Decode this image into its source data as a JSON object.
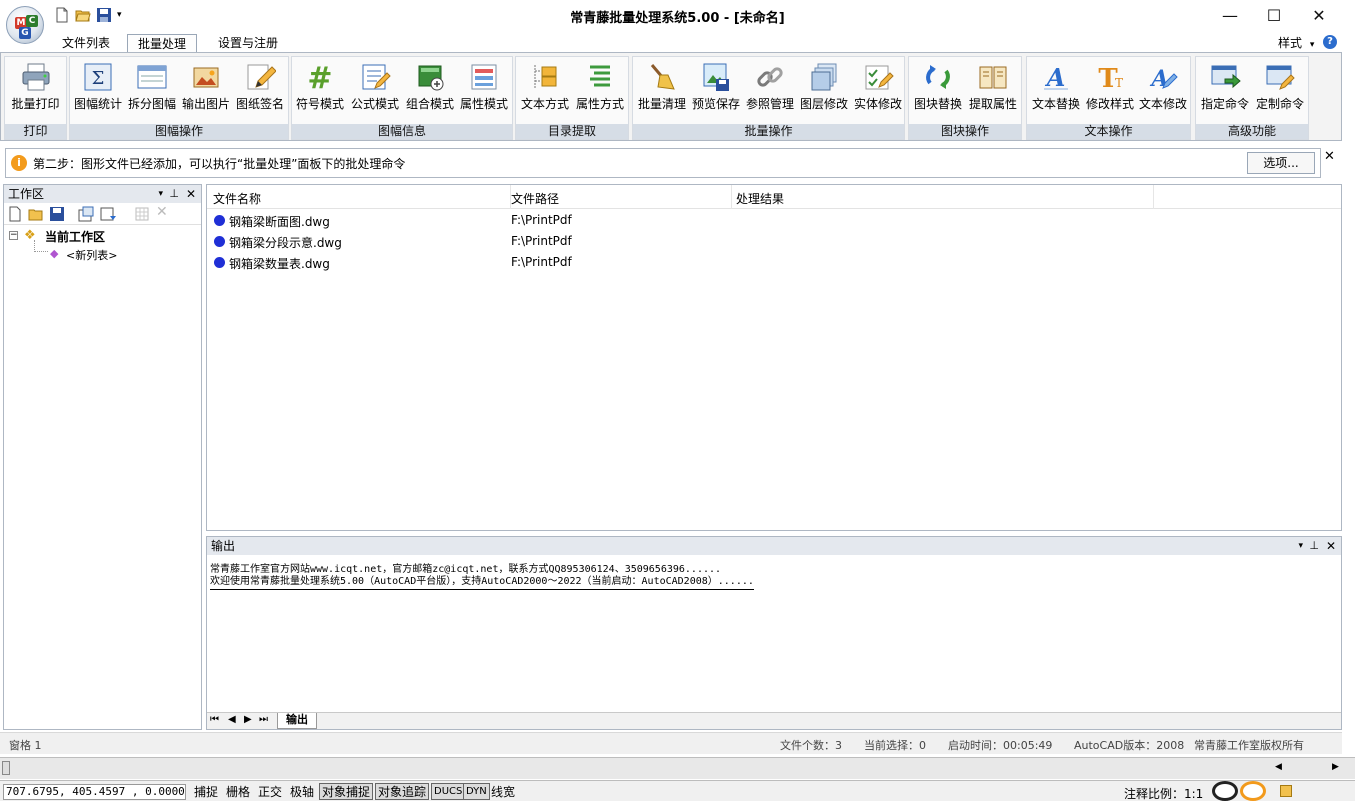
{
  "window": {
    "title": "常青藤批量处理系统5.00 - [未命名]",
    "controls": {
      "minimize": "—",
      "maximize": "☐",
      "close": "✕"
    }
  },
  "tabs": [
    {
      "label": "文件列表",
      "active": false
    },
    {
      "label": "批量处理",
      "active": true
    },
    {
      "label": "设置与注册",
      "active": false
    }
  ],
  "style_menu": {
    "label": "样式",
    "arrow": "▾",
    "help": "?"
  },
  "ribbon": {
    "groups": [
      {
        "label": "打印",
        "buttons": [
          {
            "label": "批量打印",
            "icon": "printer-icon"
          }
        ]
      },
      {
        "label": "图幅操作",
        "buttons": [
          {
            "label": "图幅统计",
            "icon": "sigma-icon"
          },
          {
            "label": "拆分图幅",
            "icon": "split-frame-icon"
          },
          {
            "label": "输出图片",
            "icon": "picture-icon"
          },
          {
            "label": "图纸签名",
            "icon": "sign-pencil-icon"
          }
        ]
      },
      {
        "label": "图幅信息",
        "buttons": [
          {
            "label": "符号模式",
            "icon": "hash-icon"
          },
          {
            "label": "公式模式",
            "icon": "formula-icon"
          },
          {
            "label": "组合模式",
            "icon": "combine-icon"
          },
          {
            "label": "属性模式",
            "icon": "attribute-icon"
          }
        ]
      },
      {
        "label": "目录提取",
        "buttons": [
          {
            "label": "文本方式",
            "icon": "folder-tree-icon"
          },
          {
            "label": "属性方式",
            "icon": "list-lines-icon"
          }
        ]
      },
      {
        "label": "批量操作",
        "buttons": [
          {
            "label": "批量清理",
            "icon": "broom-icon"
          },
          {
            "label": "预览保存",
            "icon": "preview-save-icon"
          },
          {
            "label": "参照管理",
            "icon": "chain-link-icon"
          },
          {
            "label": "图层修改",
            "icon": "layers-icon"
          },
          {
            "label": "实体修改",
            "icon": "entity-edit-icon"
          }
        ]
      },
      {
        "label": "图块操作",
        "buttons": [
          {
            "label": "图块替换",
            "icon": "block-replace-icon"
          },
          {
            "label": "提取属性",
            "icon": "book-icon"
          }
        ]
      },
      {
        "label": "文本操作",
        "buttons": [
          {
            "label": "文本替换",
            "icon": "text-replace-icon"
          },
          {
            "label": "修改样式",
            "icon": "text-style-icon"
          },
          {
            "label": "文本修改",
            "icon": "text-edit-icon"
          }
        ]
      },
      {
        "label": "高级功能",
        "buttons": [
          {
            "label": "指定命令",
            "icon": "command-run-icon"
          },
          {
            "label": "定制命令",
            "icon": "command-custom-icon"
          }
        ]
      }
    ]
  },
  "infobar": {
    "message": "第二步：图形文件已经添加，可以执行“批量处理”面板下的批处理命令",
    "options_button": "选项...",
    "close": "✕"
  },
  "workspace": {
    "title": "工作区",
    "root": "当前工作区",
    "child": "<新列表>"
  },
  "file_table": {
    "headers": [
      "文件名称",
      "文件路径",
      "处理结果"
    ],
    "rows": [
      {
        "name": "钢箱梁断面图.dwg",
        "path": "F:\\PrintPdf",
        "result": ""
      },
      {
        "name": "钢箱梁分段示意.dwg",
        "path": "F:\\PrintPdf",
        "result": ""
      },
      {
        "name": "钢箱梁数量表.dwg",
        "path": "F:\\PrintPdf",
        "result": ""
      }
    ]
  },
  "output": {
    "title": "输出",
    "lines": [
      "常青藤工作室官方网站www.icqt.net，官方邮箱zc@icqt.net，联系方式QQ895306124、3509656396......",
      "欢迎使用常青藤批量处理系统5.00（AutoCAD平台版），支持AutoCAD2000～2022（当前启动：AutoCAD2008）......"
    ],
    "tab": "输出"
  },
  "statusbar": {
    "left": "窗格 1",
    "file_count": "文件个数：3",
    "current_selection": "当前选择：0",
    "start_time": "启动时间：00:05:49",
    "autocad_version": "AutoCAD版本：2008",
    "copyright": "常青藤工作室版权所有"
  },
  "acad_status": {
    "coords": "707.6795,  405.4597 , 0.0000",
    "toggles": [
      {
        "label": "捕捉",
        "on": false
      },
      {
        "label": "栅格",
        "on": false
      },
      {
        "label": "正交",
        "on": false
      },
      {
        "label": "极轴",
        "on": false
      },
      {
        "label": "对象捕捉",
        "on": true
      },
      {
        "label": "对象追踪",
        "on": true
      },
      {
        "label": "DUCS",
        "on": true
      },
      {
        "label": "DYN",
        "on": true
      },
      {
        "label": "线宽",
        "on": false
      }
    ],
    "annotation_scale": "注释比例：1:1"
  }
}
